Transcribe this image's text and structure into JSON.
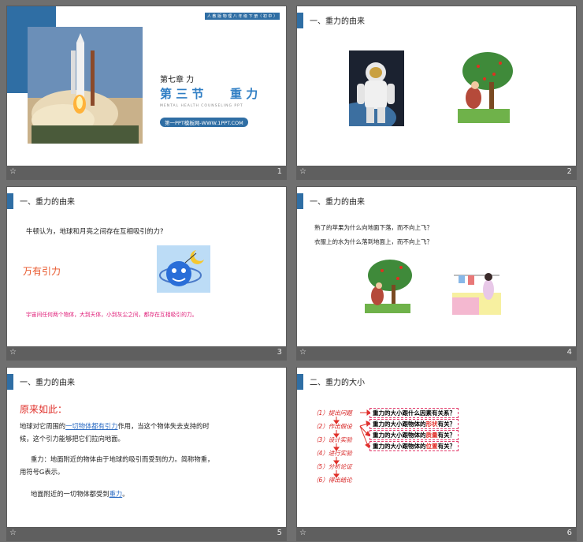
{
  "slides": [
    {
      "num": "1",
      "badge": "人 教 版 物 理 八 年 级 下 册（ 初 中 ）",
      "chapter": "第七章  力",
      "section": "第 三 节",
      "topic": "重 力",
      "subtitle": "MENTAL  HEALTH  COUNSELING  PPT",
      "link": "第一PPT模板网-WWW.1PPT.COM"
    },
    {
      "num": "2",
      "title": "一、重力的由来"
    },
    {
      "num": "3",
      "title": "一、重力的由来",
      "line1": "牛顿认为，地球和月亮之间存在互相吸引的力?",
      "big": "万有引力",
      "line2": "宇宙间任何两个物体，大到天体，小到灰尘之间，都存在互相吸引的力。"
    },
    {
      "num": "4",
      "title": "一、重力的由来",
      "q1": "熟了的苹果为什么向地面下落，而不向上飞？",
      "q2": "衣服上的水为什么落到地面上，而不向上飞？"
    },
    {
      "num": "5",
      "title": "一、重力的由来",
      "head": "原来如此：",
      "p1a": "地球对它周围的",
      "p1link": "一切物体都有引力",
      "p1b": "作用，当这个物体失去支持的时",
      "p1c": "候，这个引力能够把它们拉向地面。",
      "p2": "重力：地面附近的物体由于地球的吸引而受到的力。简称物重，",
      "p2b": "用符号G表示。",
      "p3a": "地面附近的一切物体都受到",
      "p3link": "重力",
      "p3b": "。"
    },
    {
      "num": "6",
      "title": "二、重力的大小",
      "steps": [
        "（1）提出问题",
        "（2）作出假设",
        "（3）设计实验",
        "（4）进行实验",
        "（5）分析论证",
        "（6）得出结论"
      ],
      "questions": [
        {
          "a": "重力的大小跟什么因素有关系？",
          "h": "",
          "b": ""
        },
        {
          "a": "重力的大小跟物体的",
          "h": "形状",
          "b": "有关？"
        },
        {
          "a": "重力的大小跟物体的",
          "h": "质量",
          "b": "有关？"
        },
        {
          "a": "重力的大小跟物体的",
          "h": "位置",
          "b": "有关？"
        }
      ]
    }
  ],
  "footer_star": "☆",
  "colors": {
    "accent": "#2f6ea4",
    "red": "#e0302a",
    "pink": "#e02a6a"
  }
}
